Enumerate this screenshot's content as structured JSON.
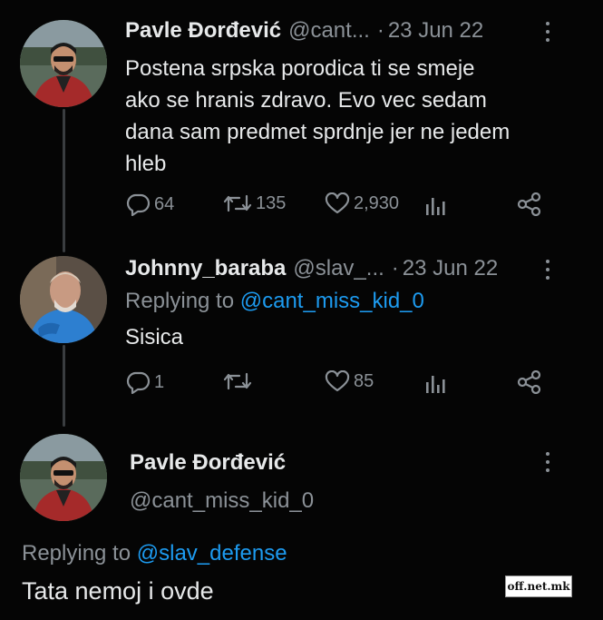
{
  "tweets": [
    {
      "name": "Pavle Đorđević",
      "handle": "@cant...",
      "dot": "·",
      "date": "23 Jun 22",
      "lines": [
        "Postena srpska porodica ti se smeje",
        "ako se hranis zdravo. Evo vec sedam",
        "dana sam predmet sprdnje jer ne jedem",
        "hleb"
      ],
      "replies": "64",
      "retweets": "135",
      "likes": "2,930"
    },
    {
      "name": "Johnny_baraba",
      "handle": "@slav_...",
      "dot": "·",
      "date": "23 Jun 22",
      "replying_prefix": "Replying to ",
      "replying_to": "@cant_miss_kid_0",
      "text": "Sisica",
      "replies": "1",
      "retweets": "",
      "likes": "85"
    },
    {
      "name": "Pavle Đorđević",
      "handle": "@cant_miss_kid_0",
      "replying_prefix": "Replying to ",
      "replying_to": "@slav_defense",
      "text": "Tata nemoj i ovde"
    }
  ],
  "watermark": "off.net.mk",
  "icons": {
    "reply": "reply-icon",
    "retweet": "retweet-icon",
    "like": "heart-icon",
    "views": "analytics-icon",
    "share": "share-icon",
    "more": "more-icon"
  },
  "colors": {
    "background": "#050505",
    "text": "#e7e9ea",
    "muted": "#8b9197",
    "link": "#1d9bf0"
  }
}
